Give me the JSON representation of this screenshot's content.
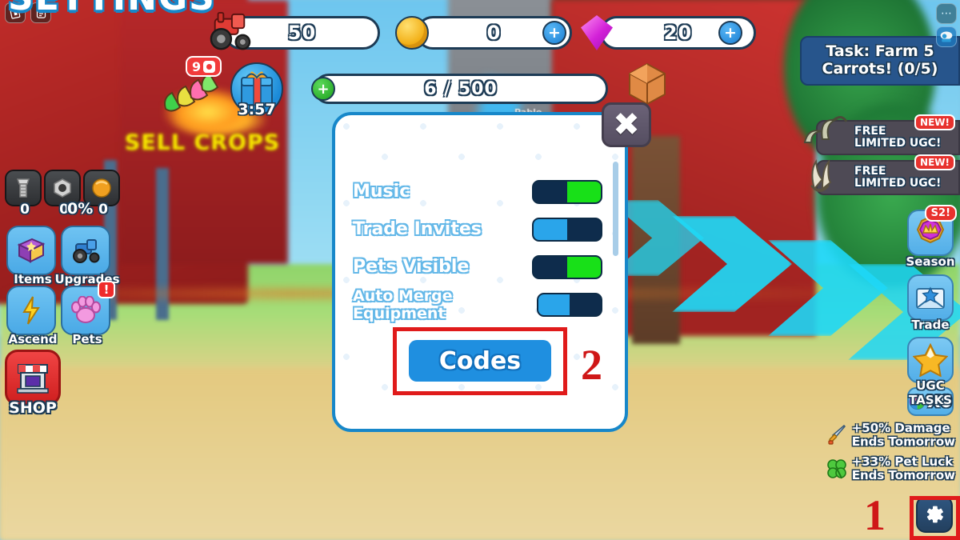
{
  "topbar": {
    "roblox_icon": "roblox-logo-icon",
    "menu_icon": "chat-menu-icon",
    "currencies": [
      {
        "id": "tractor",
        "icon": "tractor-icon",
        "value": "50",
        "has_plus": false
      },
      {
        "id": "coins",
        "icon": "coin-icon",
        "value": "0",
        "has_plus": true,
        "plus": "+"
      },
      {
        "id": "gems",
        "icon": "gem-icon",
        "value": "20",
        "has_plus": true,
        "plus": "+"
      }
    ]
  },
  "xp": {
    "text": "6 / 500",
    "plus": "+",
    "crate_icon": "crate-icon"
  },
  "potions": {
    "icon": "potions-icon",
    "badge_count": "9"
  },
  "gift": {
    "icon": "gift-box-icon",
    "timer": "3:57"
  },
  "left_hud": {
    "materials": [
      {
        "icon": "screw-icon",
        "value": "0"
      },
      {
        "icon": "nut-icon",
        "value": "0"
      },
      {
        "icon": "ball-icon",
        "value": "0"
      }
    ],
    "buttons": [
      {
        "icon": "book-icon",
        "label": "Items"
      },
      {
        "icon": "tractor-icon",
        "label": "Upgrades",
        "percent": "0%"
      },
      {
        "icon": "bolt-icon",
        "label": "Ascend"
      },
      {
        "icon": "paw-icon",
        "label": "Pets",
        "badge": "!"
      }
    ],
    "shop": {
      "icon": "shop-icon",
      "label": "SHOP"
    }
  },
  "right_hud": {
    "top_icons": [
      {
        "icon": "ellipsis-icon"
      },
      {
        "icon": "camera-robot-icon"
      }
    ],
    "task": "Task: Farm 5\nCarrots! (0/5)",
    "task_line1": "Task: Farm 5",
    "task_line2": "Carrots! (0/5)",
    "ugc_offers": [
      {
        "icon": "horns-ugc-icon",
        "line1": "FREE",
        "line2": "LIMITED UGC!",
        "badge": "NEW!"
      },
      {
        "icon": "claw-ugc-icon",
        "line1": "FREE",
        "line2": "LIMITED UGC!",
        "badge": "NEW!"
      }
    ],
    "buttons": [
      {
        "icon": "season-crown-icon",
        "label": "Season",
        "badge": "S2!"
      },
      {
        "icon": "envelope-star-icon",
        "label": "Trade"
      },
      {
        "icon": "star-icon",
        "label": "UGC TASKS"
      }
    ],
    "multiplier_chip": {
      "icon": "rainbow-pinwheel-icon",
      "text": "X0"
    },
    "boosts": [
      {
        "icon": "sword-icon",
        "line1": "+50% Damage",
        "line2": "Ends Tomorrow"
      },
      {
        "icon": "clover-icon",
        "line1": "+33% Pet Luck",
        "line2": "Ends Tomorrow"
      }
    ],
    "settings_gear": "gear-icon"
  },
  "settings_panel": {
    "title": "SETTINGS",
    "close_label": "✖",
    "rows": [
      {
        "label": "Music",
        "state": "on"
      },
      {
        "label": "Trade Invites",
        "state": "off"
      },
      {
        "label": "Pets Visible",
        "state": "on"
      },
      {
        "label": "Auto Merge Equipment",
        "state": "off"
      }
    ],
    "codes_button": "Codes"
  },
  "annotations": [
    {
      "number": "1",
      "target": "settings-gear-button"
    },
    {
      "number": "2",
      "target": "codes-button"
    }
  ],
  "scene": {
    "sign_text": "SELL CROPS",
    "player_name": "Pablo"
  },
  "colors": {
    "panel_border": "#1787c9",
    "toggle_on": "#18e018",
    "toggle_off": "#2aa5ea",
    "toggle_track": "#0e2c4c",
    "codes_blue": "#1f8fe0",
    "annotation_red": "#e01b1b",
    "task_blue": "#27558c",
    "shop_red": "#cf1f1f"
  }
}
